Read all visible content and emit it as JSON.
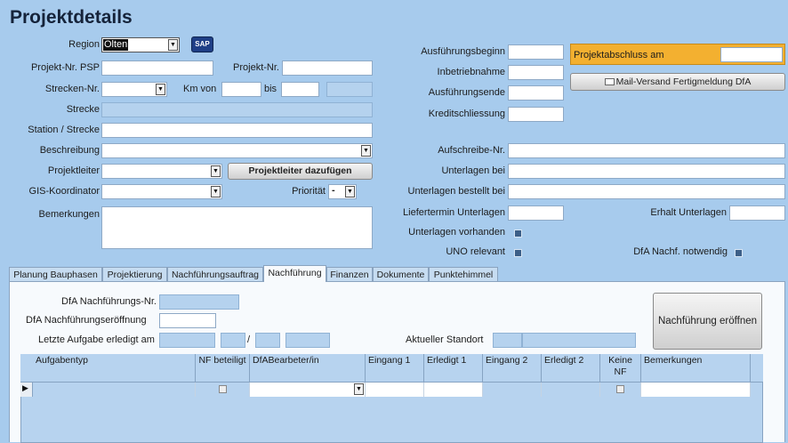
{
  "header": {
    "title": "Projektdetails"
  },
  "form": {
    "region_label": "Region",
    "region_value": "Olten",
    "sap_button": "SAP",
    "projekt_nr_psp_label": "Projekt-Nr. PSP",
    "projekt_nr_label": "Projekt-Nr.",
    "strecken_nr_label": "Strecken-Nr.",
    "km_von_label": "Km von",
    "bis_label": "bis",
    "strecke_label": "Strecke",
    "station_label": "Station / Strecke",
    "beschreibung_label": "Beschreibung",
    "projektleiter_label": "Projektleiter",
    "projektleiter_button": "Projektleiter dazufügen",
    "gis_label": "GIS-Koordinator",
    "prioritaet_label": "Priorität",
    "prioritaet_value": "-",
    "bemerkungen_label": "Bemerkungen",
    "ausfuehrungsbeginn_label": "Ausführungsbeginn",
    "inbetriebnahme_label": "Inbetriebnahme",
    "ausfuehrungsende_label": "Ausführungsende",
    "kreditschliessung_label": "Kreditschliessung",
    "projektabschluss_label": "Projektabschluss am",
    "mail_button": "Mail-Versand Fertigmeldung DfA",
    "aufschreibe_label": "Aufschreibe-Nr.",
    "unterlagen_bei_label": "Unterlagen bei",
    "unterlagen_bestellt_label": "Unterlagen bestellt bei",
    "liefertermin_label": "Liefertermin Unterlagen",
    "erhalt_label": "Erhalt Unterlagen",
    "unterlagen_vorhanden_label": "Unterlagen vorhanden",
    "uno_label": "UNO relevant",
    "dfa_nachf_label": "DfA Nachf. notwendig"
  },
  "tabs": [
    {
      "label": "Planung Bauphasen"
    },
    {
      "label": "Projektierung"
    },
    {
      "label": "Nachführungsauftrag"
    },
    {
      "label": "Nachführung"
    },
    {
      "label": "Finanzen"
    },
    {
      "label": "Dokumente"
    },
    {
      "label": "Punktehimmel"
    }
  ],
  "panel": {
    "dfa_nr_label": "DfA Nachführungs-Nr.",
    "dfa_eroeffnung_label": "DfA Nachführungseröffnung",
    "letzte_aufgabe_label": "Letzte Aufgabe erledigt am",
    "slash": "/",
    "aktueller_standort_label": "Aktueller Standort",
    "eroeffnen_button": "Nachführung eröffnen"
  },
  "grid": {
    "columns": [
      "Aufgabentyp",
      "NF beteiligt",
      "DfABearbeter/in",
      "Eingang 1",
      "Erledigt 1",
      "Eingang 2",
      "Erledigt 2",
      "Keine NF",
      "Bemerkungen"
    ],
    "row_marker": "▶"
  },
  "colors": {
    "background": "#a7cbed",
    "highlight": "#f3b030",
    "panel": "#f7fafd"
  }
}
